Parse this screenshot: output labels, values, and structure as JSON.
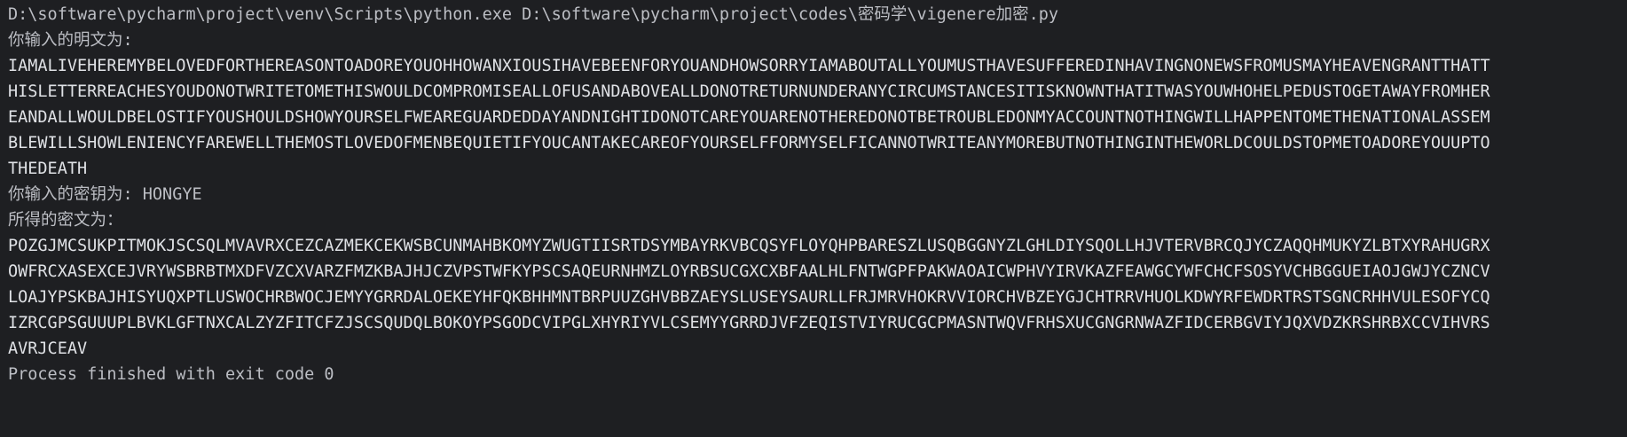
{
  "console": {
    "command_line": "D:\\software\\pycharm\\project\\venv\\Scripts\\python.exe D:\\software\\pycharm\\project\\codes\\密码学\\vigenere加密.py",
    "plaintext_prompt": "你输入的明文为:",
    "plaintext_lines": [
      "IAMALIVEHEREMYBELOVEDFORTHEREASONTOADOREYOUOHHOWANXIOUSIHAVEBEENFORYOUANDHOWSORRYIAMABOUTALLYOUMUSTHAVESUFFEREDINHAVINGNONEWSFROMUSMAYHEAVENGRANTTHATT",
      "HISLETTERREACHESYOUDONOTWRITETOMETHISWOULDCOMPROMISEALLOFUSANDABOVEALLDONOTRETURNUNDERANYCIRCUMSTANCESITISKNOWNTHATITWASYOUWHOHELPEDUSTOGETAWAYFROMHER",
      "EANDALLWOULDBELOSTIFYOUSHOULDSHOWYOURSELFWEAREGUARDEDDAYANDNIGHTIDONOTCAREYOUARENOTHEREDONOTBETROUBLEDONMYACCOUNTNOTHINGWILLHAPPENTOMETHENATIONALASSEM",
      "BLEWILLSHOWLENIENCYFAREWELLTHEMOSTLOVEDOFMENBEQUIETIFYOUCANTAKECAREOFYOURSELFFORMYSELFICANNOTWRITEANYMOREBUTNOTHINGINTHEWORLDCOULDSTOPMETOADOREYOUUPTO",
      "THEDEATH"
    ],
    "key_line": "你输入的密钥为: HONGYE",
    "ciphertext_prompt": "所得的密文为：",
    "ciphertext_lines": [
      "POZGJMCSUKPITMOKJSCSQLMVAVRXCEZCAZMEKCEKWSBCUNMAHBKOMYZWUGTIISRTDSYMBAYRKVBCQSYFLOYQHPBARESZLUSQBGGNYZLGHLDIYSQOLLHJVTERVBRCQJYCZAQQHMUKYZLBTXYRAHUGRX",
      "OWFRCXASEXCEJVRYWSBRBTMXDFVZCXVARZFMZKBAJHJCZVPSTWFKYPSCSAQEURNHMZLOYRBSUCGXCXBFAALHLFNTWGPFPAKWAOAICWPHVYIRVKAZFEAWGCYWFCHCFSOSYVCHBGGUEIAOJGWJYCZNCV",
      "LOAJYPSKBAJHISYUQXPTLUSWOCHRBWOCJEMYYGRRDALOEKEYHFQKBHHMNTBRPUUZGHVBBZAEYSLUSEYSAURLLFRJMRVHOKRVVIORCHVBZEYGJCHTRRVHUOLKDWYRFEWDRTRSTSGNCRHHVULESOFYCQ",
      "IZRCGPSGUUUPLBVKLGFTNXCALZYZFITCFZJSCSQUDQLBOKOYPSGODCVIPGLXHYRIYVLCSEMYYGRRDJVFZEQISTVIYRUCGCPMASNTWQVFRHSXUCGNGRNWAZFIDCERBGVIYJQXVDZKRSHRBXCCVIHVRS",
      "AVRJCEAV"
    ],
    "exit_message": "Process finished with exit code 0"
  },
  "colors": {
    "background": "#1e1f22",
    "text": "#bcbec4",
    "output_text": "#dfe1e5"
  }
}
